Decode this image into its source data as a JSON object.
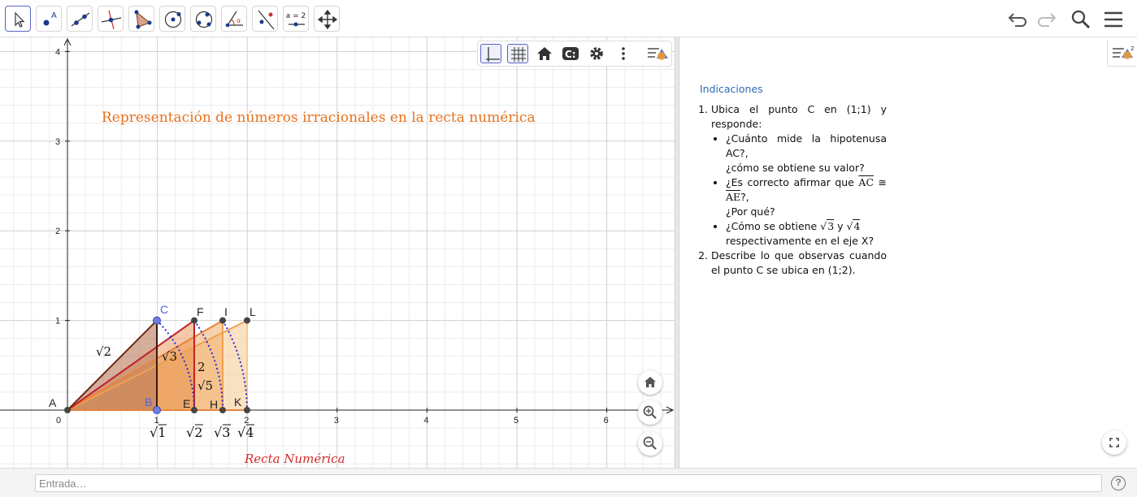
{
  "toolbar": {
    "tools": [
      {
        "name": "move-tool",
        "label": ""
      },
      {
        "name": "point-tool",
        "label": ""
      },
      {
        "name": "line-tool",
        "label": ""
      },
      {
        "name": "perpendicular-tool",
        "label": ""
      },
      {
        "name": "polygon-tool",
        "label": ""
      },
      {
        "name": "circle-center-point-tool",
        "label": ""
      },
      {
        "name": "circle-three-points-tool",
        "label": ""
      },
      {
        "name": "angle-tool",
        "label": ""
      },
      {
        "name": "reflect-tool",
        "label": ""
      },
      {
        "name": "slider-tool",
        "label": "a = 2"
      },
      {
        "name": "move-graphics-tool",
        "label": ""
      }
    ],
    "right_icons": [
      "undo-icon",
      "redo-icon",
      "search-icon",
      "menu-icon"
    ]
  },
  "graphics": {
    "title": "Representación de números irracionales en la recta numérica",
    "title_color": "#e8711d",
    "axis_caption": "Recta Numérica",
    "axis_caption_color": "#d42a2a",
    "x_ticks": [
      "0",
      "1",
      "2",
      "3",
      "4",
      "5",
      "6"
    ],
    "y_ticks": [
      "1",
      "2",
      "3",
      "4"
    ],
    "points": {
      "A": "A",
      "B": "B",
      "C": "C",
      "E": "E",
      "F": "F",
      "H": "H",
      "I": "I",
      "K": "K",
      "L": "L"
    },
    "segment_labels": {
      "ac": "√2",
      "ae": "√3",
      "af": "2",
      "ah": "√5"
    },
    "root_labels": [
      {
        "sym": "√",
        "rad": "1"
      },
      {
        "sym": "√",
        "rad": "2"
      },
      {
        "sym": "√",
        "rad": "3"
      },
      {
        "sym": "√",
        "rad": "4"
      }
    ],
    "style_bar_icons": [
      "axes-icon",
      "grid-icon",
      "home-icon",
      "label-style-icon",
      "settings-icon",
      "more-vert-icon",
      "graphics-view-icon"
    ],
    "nav_icons": [
      "home-icon",
      "zoom-in-icon",
      "zoom-out-icon"
    ]
  },
  "algebra": {
    "title": "Indicaciones",
    "items": {
      "i1_intro": "Ubica el punto C en (1;1) y responde:",
      "b1a": "¿Cuánto mide la hipotenusa AC?,",
      "b1b": "¿cómo se obtiene su valor?",
      "b2a": "¿Es correcto afirmar que ",
      "b2_ac": "AC",
      "b2_cong": " ≅ ",
      "b2_ae": "AE",
      "b2b": "?,",
      "b2c": "¿Por qué?",
      "b3a": "¿Cómo se obtiene ",
      "b3_sqrt3": "3",
      "b3_y": " y ",
      "b3_sqrt4": "4",
      "b3b": "respectivamente en el eje X?",
      "i2": "Describe lo que observas cuando el punto C se ubica en (1;2)."
    }
  },
  "input_bar": {
    "placeholder": "Entrada…",
    "help": "?"
  }
}
